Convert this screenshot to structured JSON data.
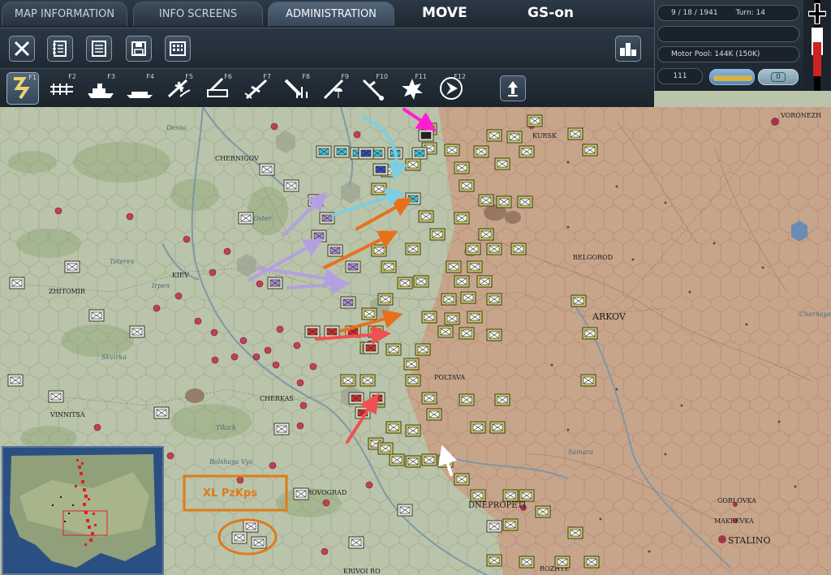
{
  "tabs": [
    {
      "label": "MAP INFORMATION"
    },
    {
      "label": "INFO SCREENS"
    },
    {
      "label": "ADMINISTRATION"
    }
  ],
  "mode": {
    "move": "MOVE",
    "gs": "GS-on"
  },
  "status": {
    "date": "9 / 18 / 1941",
    "turn": "Turn: 14",
    "motor_pool": "Motor Pool:  144K (150K)",
    "counter": "111",
    "toggle_value": "0"
  },
  "function_keys": [
    "F1",
    "F2",
    "F3",
    "F4",
    "F5",
    "F6",
    "F7",
    "F8",
    "F9",
    "F10",
    "F11",
    "F12"
  ],
  "map_labels": {
    "voronezh": "VORONEZH",
    "kursk": "KURSK",
    "chernigov": "CHERNIGOV",
    "kiev": "KIEV",
    "zhitomir": "ZHITOMIR",
    "belgorod": "BELGOROD",
    "kharkov": "ARKOV",
    "poltava": "POLTAVA",
    "cherkassy": "CHERKAS",
    "vinnitsa": "VINNITSA",
    "kirovograd": "ROVOGRAD",
    "dnepropetrovsk": "DNEPROPETI",
    "gorlovka": "GORLOVKA",
    "makeevka": "MAKEEVKA",
    "stalino": "STALINO",
    "krivoi_rog": "KRIVOI RO",
    "zaporozhye": "ROZHYE",
    "skvirka": "Skvirka",
    "tikich": "Tikich",
    "bolshaya_vys": "Bolshaya Vys",
    "oster": "Oster",
    "irpen": "Irpen",
    "teterev": "Teterev",
    "desna": "Desna",
    "samara": "Samara",
    "chernaya": "Chernaya"
  },
  "annotation": {
    "label": "XL PzKps",
    "color": "#e07a1a"
  },
  "colors": {
    "axis_counter": "#c8c86a",
    "soviet_counter": "#d9d9c8",
    "arrow_purple": "#b4a0e0",
    "arrow_orange": "#e8701c",
    "arrow_cyan": "#7ecde0",
    "arrow_red": "#f05050",
    "arrow_magenta": "#ff1ed2",
    "arrow_white": "#ffffff"
  }
}
